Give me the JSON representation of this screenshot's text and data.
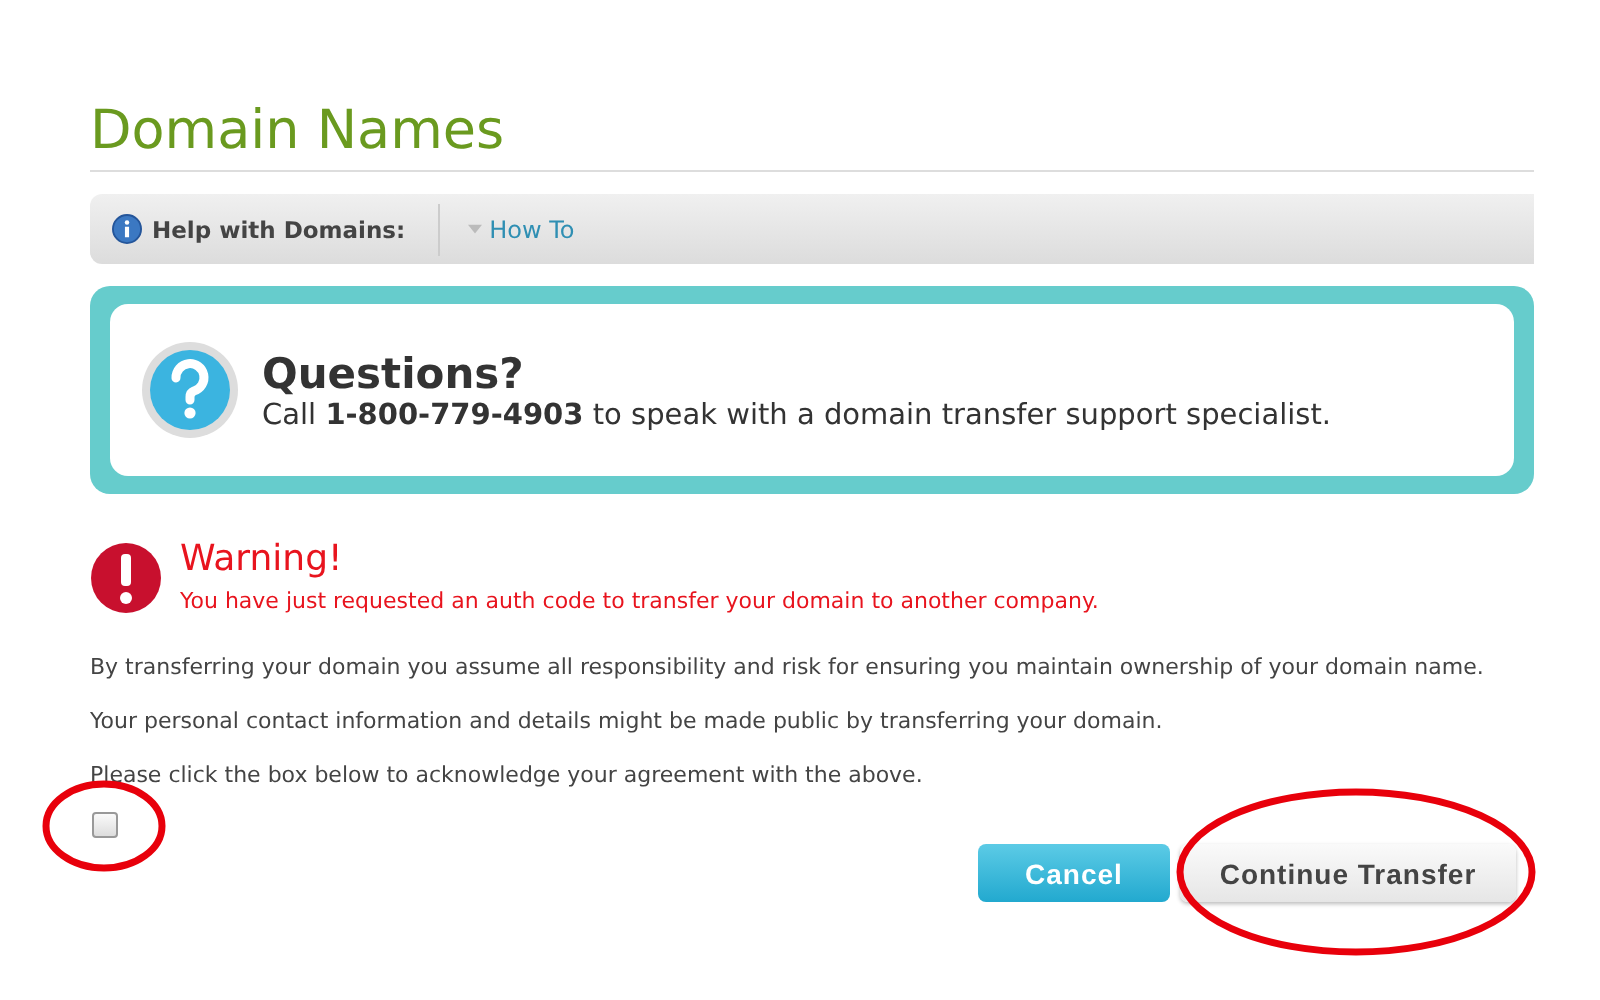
{
  "title": "Domain Names",
  "help_bar": {
    "label": "Help with Domains:",
    "link": "How To"
  },
  "questions": {
    "heading": "Questions?",
    "text": "Call **1-800-779-4903** to speak with a domain transfer support specialist."
  },
  "warning": {
    "heading": "Warning!",
    "text": "You have just requested an auth code to transfer your domain to another company."
  },
  "paragraphs": [
    "By transferring your domain you assume all responsibility and risk for ensuring you maintain ownership of your domain name.",
    "Your personal contact information and details might be made public by transferring your domain.",
    "Please click the box below to acknowledge your agreement with the above."
  ],
  "agreement": {
    "checked": false
  },
  "buttons": [
    {
      "label": "Cancel",
      "kind": "primary"
    },
    {
      "label": "Continue Transfer",
      "kind": "secondary"
    }
  ]
}
